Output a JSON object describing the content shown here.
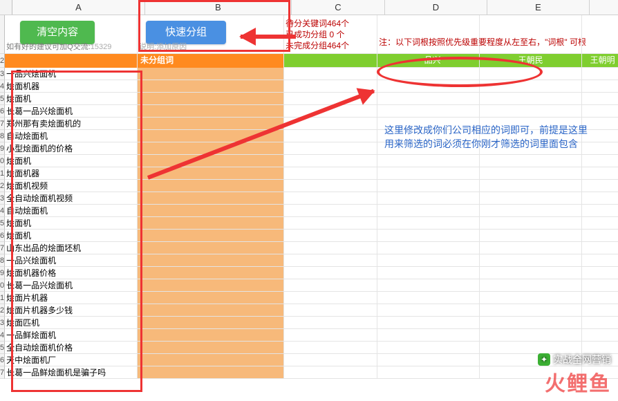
{
  "columns": {
    "A": "A",
    "B": "B",
    "C": "C",
    "D": "D",
    "E": "E"
  },
  "row1": {
    "btn_clear": "清空内容",
    "btn_group": "快速分组",
    "under_note_prefix": "如有好的建议可加Q交流:",
    "under_note_qq": "15329",
    "under_note_suffix": "说明:添加原因",
    "status1": "待分关键词464个",
    "status2": "已成功分组 0 个",
    "status3": "未完成分组464个",
    "note": "注：以下词根按照优先级重要程度从左至右，\"词根\" 可根"
  },
  "row2": {
    "b": "未分组词",
    "d": "一品兴",
    "e": "王朝民",
    "f": "王朝明"
  },
  "list": [
    "一品兴烩面机",
    "烩面机器",
    "烩面机",
    "长葛一品兴烩面机",
    "郑州那有卖烩面机的",
    "自动烩面机",
    "小型烩面机的价格",
    "烩面机",
    "烩面机器",
    "烩面机视频",
    "全自动烩面机视频",
    "自动烩面机",
    "烩面机",
    "烩面机",
    "山东出品的烩面坯机",
    "一品兴烩面机",
    "烩面机器价格",
    "长葛一品兴烩面机",
    "烩面片机器",
    "烩面片机器多少钱",
    "烩面匹机",
    "一品鲜烩面机",
    "全自动烩面机价格",
    "天中烩面机厂",
    "长葛一品鲜烩面机是骗子吗"
  ],
  "rownums": [
    "2",
    "3",
    "4",
    "5",
    "6",
    "7",
    "8",
    "9",
    "0",
    "1",
    "2",
    "3",
    "4",
    "5",
    "6",
    "7",
    "8",
    "9",
    "0",
    "1",
    "2",
    "3",
    "4",
    "5",
    "6",
    "7"
  ],
  "tip": "这里修改成你们公司相应的词即可，前提是这里用来筛选的词必须在你刚才筛选的词里面包含",
  "watermark": {
    "wechat": "实战全网营销",
    "logo": "火鲤鱼"
  }
}
